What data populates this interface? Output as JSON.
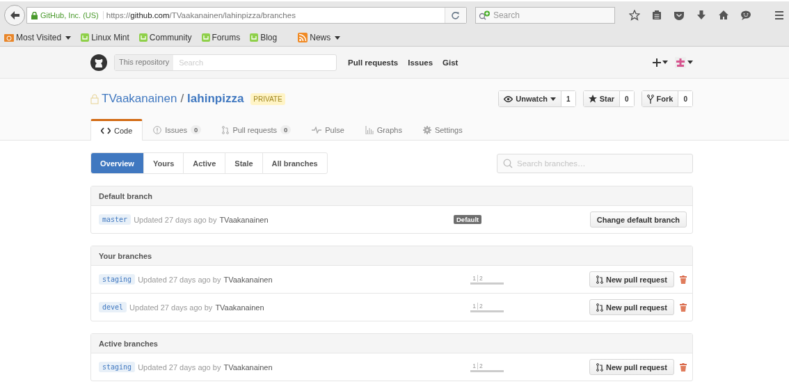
{
  "browser": {
    "site_identity": "GitHub, Inc. (US)",
    "url_prefix": "https://",
    "url_host": "github.com",
    "url_path": "/TVaakanainen/lahinpizza/branches",
    "search_placeholder": "Search",
    "bookmarks": [
      {
        "kind": "folder",
        "label": "Most Visited",
        "dropdown": true
      },
      {
        "kind": "mint",
        "label": "Linux Mint",
        "dropdown": false
      },
      {
        "kind": "mint",
        "label": "Community",
        "dropdown": false
      },
      {
        "kind": "mint",
        "label": "Forums",
        "dropdown": false
      },
      {
        "kind": "mint",
        "label": "Blog",
        "dropdown": false
      },
      {
        "kind": "rss",
        "label": "News",
        "dropdown": true
      }
    ]
  },
  "header": {
    "scope": "This repository",
    "search_placeholder": "Search",
    "nav": [
      "Pull requests",
      "Issues",
      "Gist"
    ]
  },
  "repo": {
    "owner": "TVaakanainen",
    "separator": "/",
    "name": "lahinpizza",
    "visibility": "PRIVATE",
    "actions": [
      {
        "kind": "watch",
        "label": "Unwatch",
        "count": "1",
        "dropdown": true
      },
      {
        "kind": "star",
        "label": "Star",
        "count": "0",
        "dropdown": false
      },
      {
        "kind": "fork",
        "label": "Fork",
        "count": "0",
        "dropdown": false
      }
    ],
    "tabs": [
      {
        "kind": "code",
        "label": "Code",
        "selected": true
      },
      {
        "kind": "issues",
        "label": "Issues",
        "count": "0",
        "selected": false
      },
      {
        "kind": "pulls",
        "label": "Pull requests",
        "count": "0",
        "selected": false
      },
      {
        "kind": "pulse",
        "label": "Pulse",
        "selected": false
      },
      {
        "kind": "graphs",
        "label": "Graphs",
        "selected": false
      },
      {
        "kind": "settings",
        "label": "Settings",
        "selected": false
      }
    ]
  },
  "filters": [
    {
      "label": "Overview",
      "selected": true
    },
    {
      "label": "Yours",
      "selected": false
    },
    {
      "label": "Active",
      "selected": false
    },
    {
      "label": "Stale",
      "selected": false
    },
    {
      "label": "All branches",
      "selected": false
    }
  ],
  "branch_search": {
    "placeholder": "Search branches…"
  },
  "sections": [
    {
      "title": "Default branch",
      "branches": [
        {
          "kind": "default",
          "name": "master",
          "updated": "Updated 27 days ago by",
          "author": "TVaakanainen",
          "badge": "Default",
          "action": "Change default branch"
        }
      ]
    },
    {
      "title": "Your branches",
      "branches": [
        {
          "kind": "pull",
          "name": "staging",
          "updated": "Updated 27 days ago by",
          "author": "TVaakanainen",
          "behind": "1",
          "ahead": "2",
          "action": "New pull request"
        },
        {
          "kind": "pull",
          "name": "devel",
          "updated": "Updated 27 days ago by",
          "author": "TVaakanainen",
          "behind": "1",
          "ahead": "2",
          "action": "New pull request"
        }
      ]
    },
    {
      "title": "Active branches",
      "branches": [
        {
          "kind": "pull",
          "name": "staging",
          "updated": "Updated 27 days ago by",
          "author": "TVaakanainen",
          "behind": "1",
          "ahead": "2",
          "action": "New pull request"
        }
      ]
    }
  ]
}
